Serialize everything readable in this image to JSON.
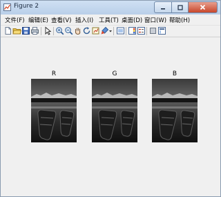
{
  "window": {
    "title": "Figure 2"
  },
  "menu": [
    {
      "label": "文件(F)"
    },
    {
      "label": "编辑(E)"
    },
    {
      "label": "查看(V)"
    },
    {
      "label": "插入(I)"
    },
    {
      "label": "工具(T)"
    },
    {
      "label": "桌面(D)"
    },
    {
      "label": "窗口(W)"
    },
    {
      "label": "帮助(H)"
    }
  ],
  "toolbar": {
    "icons": [
      "new-figure-icon",
      "open-file-icon",
      "save-icon",
      "print-icon",
      "edit-plot-arrow-icon",
      "zoom-in-icon",
      "zoom-out-icon",
      "pan-hand-icon",
      "rotate-3d-icon",
      "data-cursor-icon",
      "brush-icon",
      "link-plot-icon",
      "insert-colorbar-icon",
      "insert-legend-icon",
      "hide-plot-tools-icon",
      "show-plot-tools-icon"
    ]
  },
  "panels": [
    {
      "label": "R"
    },
    {
      "label": "G"
    },
    {
      "label": "B"
    }
  ]
}
